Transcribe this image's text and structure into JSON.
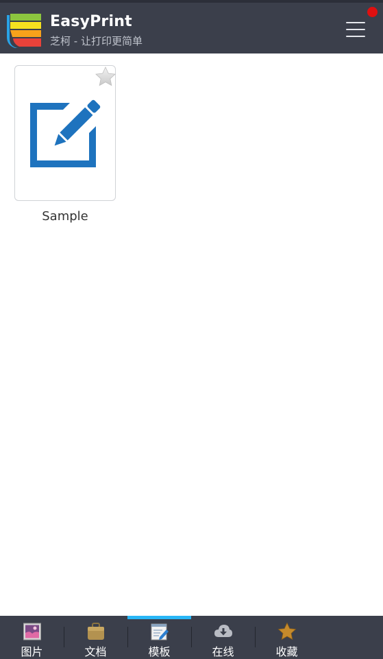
{
  "header": {
    "title": "EasyPrint",
    "subtitle": "芝柯 - 让打印更简单",
    "menu_icon": "hamburger-menu-icon",
    "notification_dot_color": "#e01010"
  },
  "templates": [
    {
      "label": "Sample",
      "icon": "edit-document-icon",
      "favorite_icon": "star-icon",
      "favorited": false
    }
  ],
  "bottom_nav": {
    "active_index": 2,
    "active_color": "#29b6f6",
    "items": [
      {
        "label": "图片",
        "icon": "picture-icon"
      },
      {
        "label": "文档",
        "icon": "briefcase-icon"
      },
      {
        "label": "模板",
        "icon": "template-edit-icon"
      },
      {
        "label": "在线",
        "icon": "cloud-download-icon"
      },
      {
        "label": "收藏",
        "icon": "star-icon"
      }
    ]
  }
}
